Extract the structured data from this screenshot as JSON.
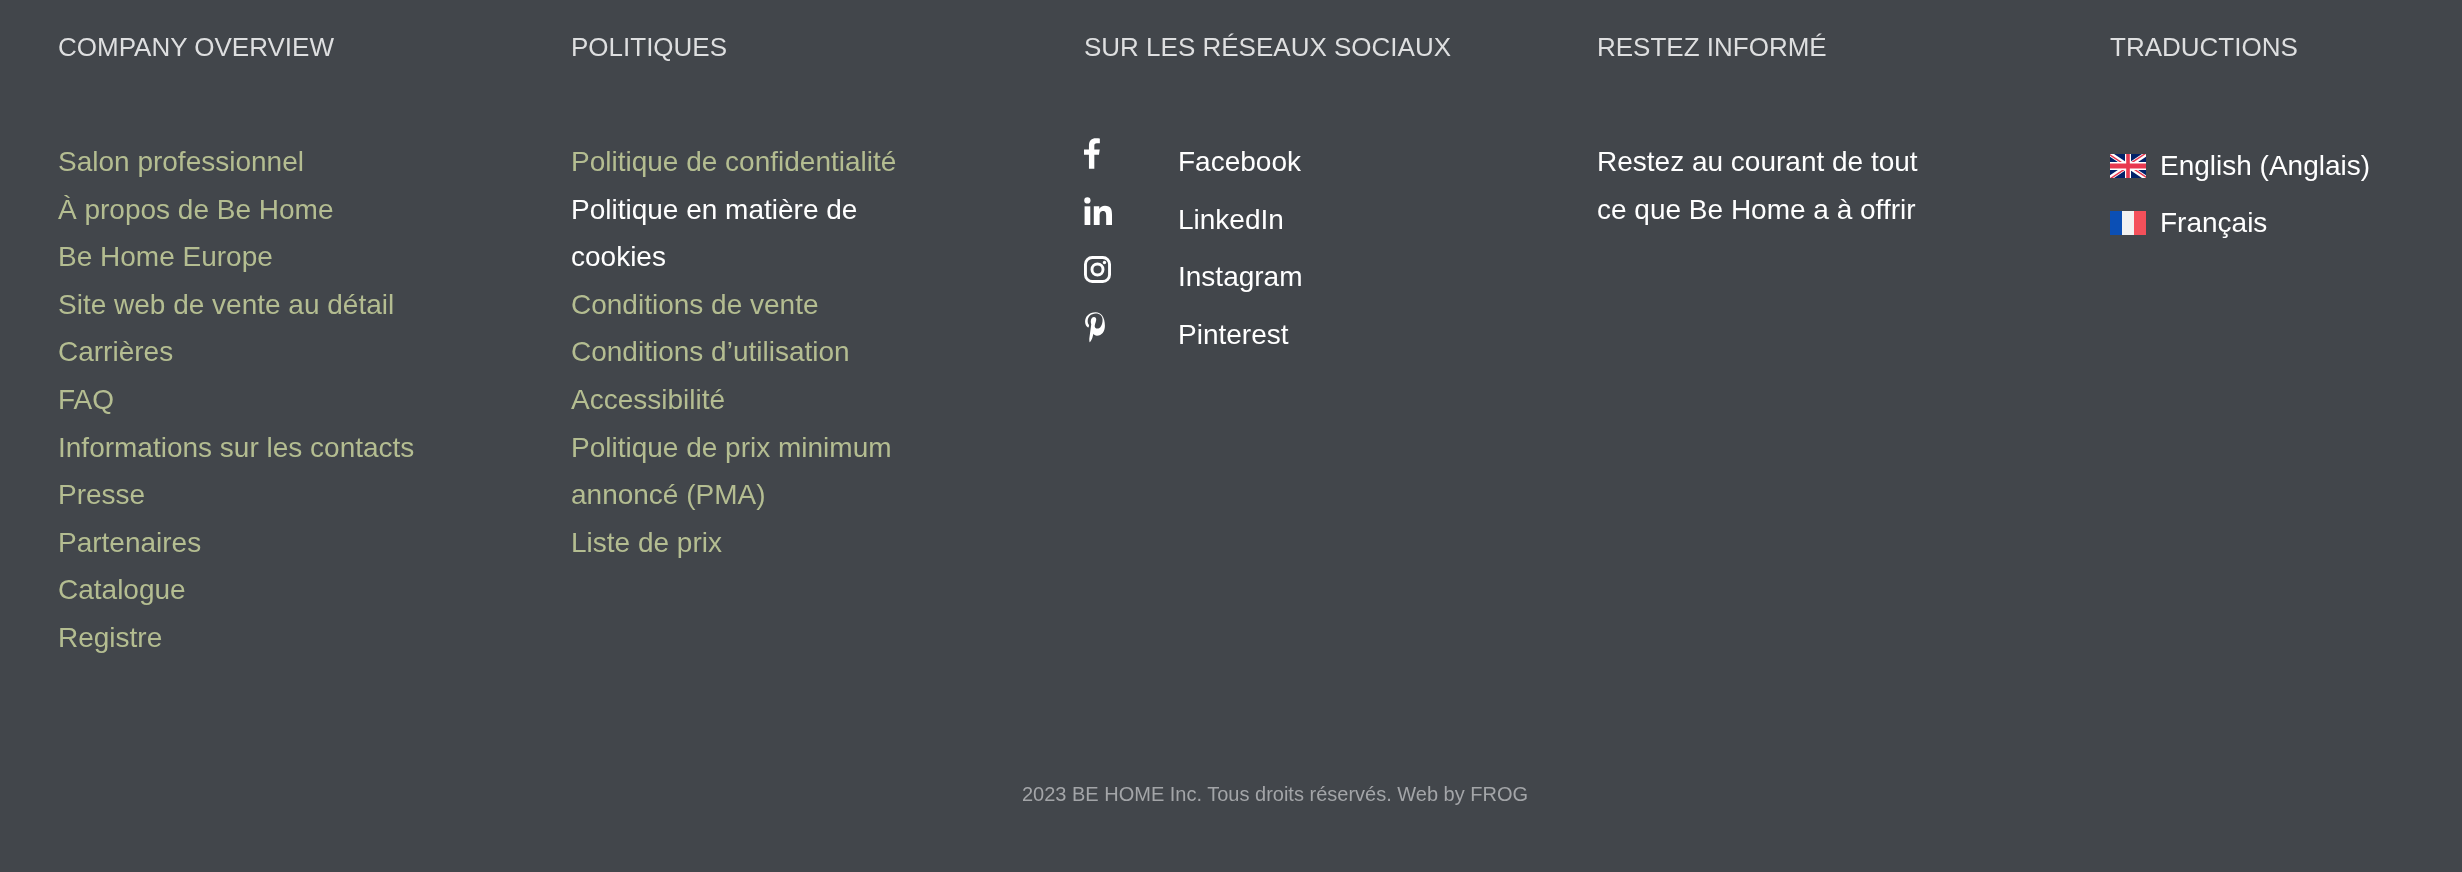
{
  "company_overview": {
    "heading": "COMPANY OVERVIEW",
    "links": [
      {
        "label": "Salon professionnel",
        "highlighted": false
      },
      {
        "label": "À propos de Be Home",
        "highlighted": false
      },
      {
        "label": "Be Home Europe",
        "highlighted": false
      },
      {
        "label": "Site web de vente au détail",
        "highlighted": false
      },
      {
        "label": "Carrières",
        "highlighted": false
      },
      {
        "label": "FAQ",
        "highlighted": false
      },
      {
        "label": "Informations sur les contacts",
        "highlighted": false
      },
      {
        "label": "Presse",
        "highlighted": false
      },
      {
        "label": "Partenaires",
        "highlighted": false
      },
      {
        "label": "Catalogue",
        "highlighted": false
      },
      {
        "label": "Registre",
        "highlighted": false
      }
    ]
  },
  "policies": {
    "heading": "POLITIQUES",
    "links": [
      {
        "label": "Politique de confidentialité",
        "highlighted": false
      },
      {
        "label": "Politique en matière de cookies",
        "highlighted": true
      },
      {
        "label": "Conditions de vente",
        "highlighted": false
      },
      {
        "label": "Conditions d’utilisation",
        "highlighted": false
      },
      {
        "label": "Accessibilité",
        "highlighted": false
      },
      {
        "label": "Politique de prix minimum annoncé (PMA)",
        "highlighted": false
      },
      {
        "label": "Liste de prix",
        "highlighted": false
      }
    ]
  },
  "social": {
    "heading": "SUR LES RÉSEAUX SOCIAUX",
    "items": [
      {
        "label": "Facebook"
      },
      {
        "label": "LinkedIn"
      },
      {
        "label": "Instagram"
      },
      {
        "label": "Pinterest"
      }
    ]
  },
  "newsletter": {
    "heading": "RESTEZ INFORMÉ",
    "text": "Restez au courant de tout ce que Be Home a à offrir"
  },
  "translations": {
    "heading": "TRADUCTIONS",
    "languages": [
      {
        "label": "English (Anglais)"
      },
      {
        "label": "Français"
      }
    ]
  },
  "copyright": "2023 BE HOME Inc. Tous droits réservés. Web by FROG"
}
